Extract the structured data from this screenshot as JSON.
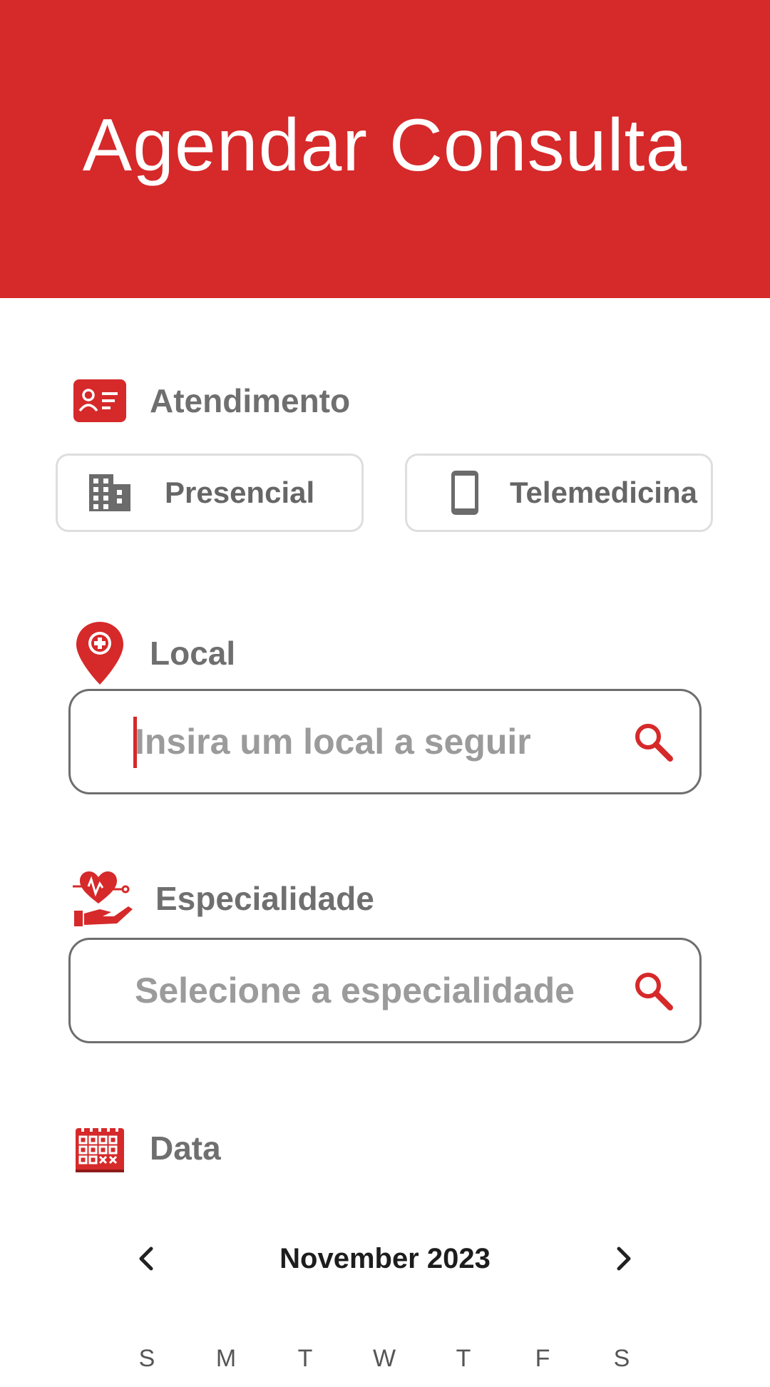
{
  "header": {
    "title": "Agendar Consulta"
  },
  "atendimento": {
    "label": "Atendimento",
    "options": [
      {
        "label": "Presencial",
        "icon": "building-icon"
      },
      {
        "label": "Telemedicina",
        "icon": "smartphone-icon"
      }
    ]
  },
  "local": {
    "label": "Local",
    "icon": "map-pin-plus-icon",
    "placeholder": "Insira um local a seguir"
  },
  "especialidade": {
    "label": "Especialidade",
    "icon": "heart-hand-icon",
    "placeholder": "Selecione a especialidade"
  },
  "data": {
    "label": "Data",
    "icon": "calendar-icon",
    "month": "November 2023",
    "weekdays": [
      "S",
      "M",
      "T",
      "W",
      "T",
      "F",
      "S"
    ]
  },
  "colors": {
    "brand": "#d6292a",
    "label_gray": "#6f6f6f",
    "placeholder_gray": "#9b9b9b",
    "border_gray": "#6e6e6e"
  }
}
